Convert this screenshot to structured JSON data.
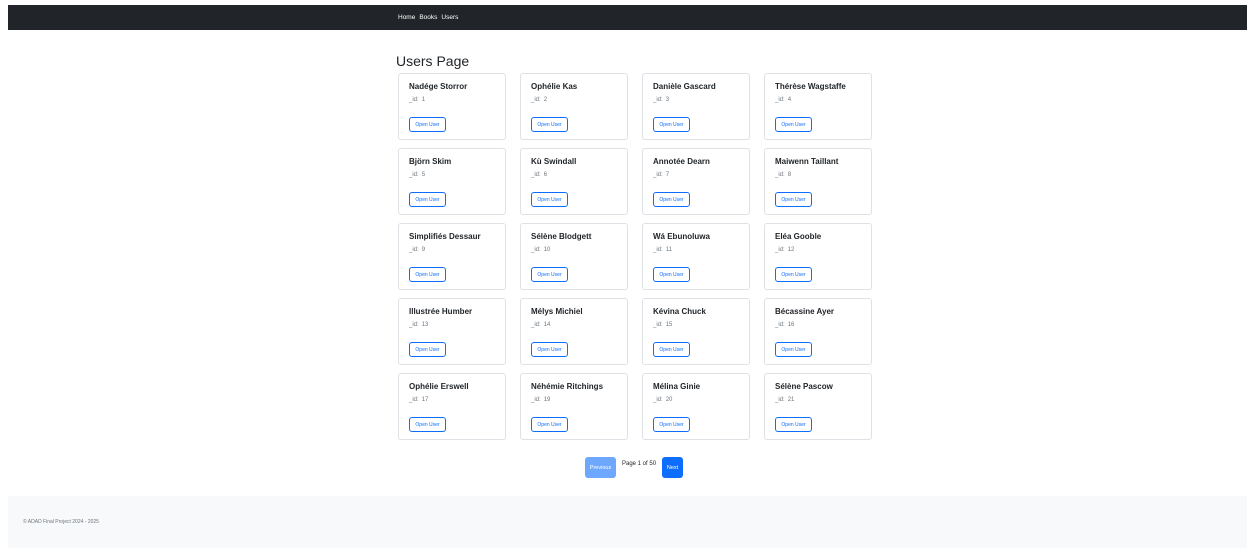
{
  "nav": {
    "home": "Home",
    "books": "Books",
    "users": "Users"
  },
  "page_title": "Users Page",
  "id_label": "_id:",
  "open_button_label": "Open User",
  "users": [
    {
      "name": "Nadége Storror",
      "id": "1"
    },
    {
      "name": "Ophélie Kas",
      "id": "2"
    },
    {
      "name": "Danièle Gascard",
      "id": "3"
    },
    {
      "name": "Thérèse Wagstaffe",
      "id": "4"
    },
    {
      "name": "Björn Skim",
      "id": "5"
    },
    {
      "name": "Kù Swindall",
      "id": "6"
    },
    {
      "name": "Annotée Dearn",
      "id": "7"
    },
    {
      "name": "Maiwenn Taillant",
      "id": "8"
    },
    {
      "name": "Simplifiés Dessaur",
      "id": "9"
    },
    {
      "name": "Sélène Blodgett",
      "id": "10"
    },
    {
      "name": "Wá Ebunoluwa",
      "id": "11"
    },
    {
      "name": "Eléa Gooble",
      "id": "12"
    },
    {
      "name": "Illustrée Humber",
      "id": "13"
    },
    {
      "name": "Mélys Michiel",
      "id": "14"
    },
    {
      "name": "Kévina Chuck",
      "id": "15"
    },
    {
      "name": "Bécassine Ayer",
      "id": "16"
    },
    {
      "name": "Ophélie Erswell",
      "id": "17"
    },
    {
      "name": "Néhémie Ritchings",
      "id": "19"
    },
    {
      "name": "Mélina Ginie",
      "id": "20"
    },
    {
      "name": "Sélène Pascow",
      "id": "21"
    }
  ],
  "pagination": {
    "previous": "Previous",
    "page_info": "Page 1 of 50",
    "next": "Next"
  },
  "footer": {
    "text": "© ADAD Final Project 2024 - 2025"
  },
  "colors": {
    "navbar": "#212529",
    "primary": "#0d6efd",
    "primary_disabled": "#6ea8fe",
    "footer_bg": "#f8f9fa"
  }
}
